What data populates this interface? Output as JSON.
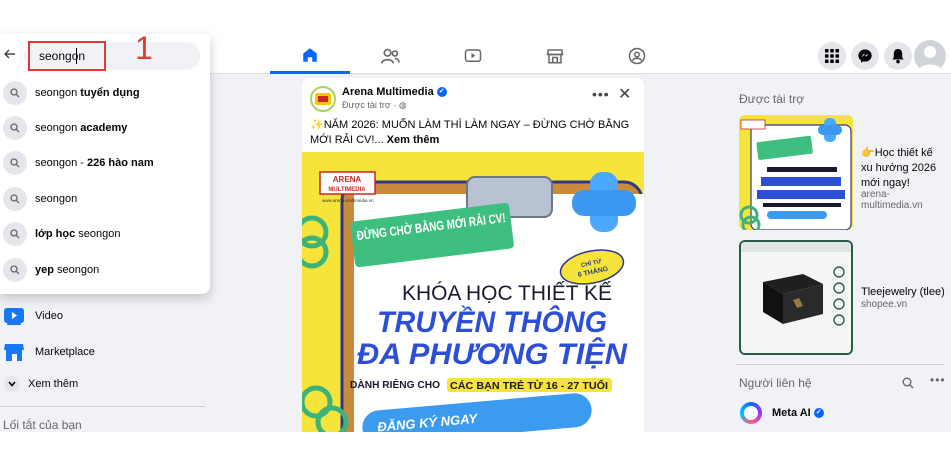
{
  "search": {
    "query": "seongon",
    "step_marker": "1",
    "suggestions": [
      {
        "prefix": "seongon ",
        "bold": "tuyển dụng"
      },
      {
        "prefix": "seongon ",
        "bold": "academy"
      },
      {
        "prefix": "seongon - ",
        "bold": "226 hào nam"
      },
      {
        "prefix": "seongon",
        "bold": ""
      },
      {
        "prefix": "",
        "bold": "lớp học",
        "suffix": " seongon"
      },
      {
        "prefix": "",
        "bold": "yep",
        "suffix": " seongon"
      }
    ]
  },
  "nav": {
    "tabs": [
      "home-icon",
      "friends-icon",
      "watch-icon",
      "marketplace-icon",
      "groups-icon"
    ],
    "active_tab": "home-icon"
  },
  "left": {
    "video_label": "Video",
    "marketplace_label": "Marketplace",
    "see_more_label": "Xem thêm",
    "shortcuts_label": "Lối tắt của bạn"
  },
  "post": {
    "author": "Arena Multimedia",
    "sponsored": "Được tài trợ · ",
    "text": "✨NĂM 2026: MUỐN LÀM THÌ LÀM NGAY – ĐỪNG CHỜ BẰNG MỚI RẢI CV!... ",
    "see_more": "Xem thêm",
    "image": {
      "logo_line1": "ARENA",
      "logo_line2": "MULTIMEDIA",
      "logo_url": "www.arena-multimedia.vn",
      "banner": "ĐỪNG CHỜ BẰNG MỚI RẢI CV!",
      "badge_line1": "CHỈ TỪ",
      "badge_line2": "6 THÁNG",
      "headline1": "KHÓA HỌC THIẾT KẾ",
      "headline2": "TRUYỀN THÔNG",
      "headline3": "ĐA PHƯƠNG TIỆN",
      "audience_prefix": "DÀNH RIÊNG CHO",
      "audience_highlight": "CÁC BẠN TRẺ TỪ 16 - 27 TUỔI",
      "cta": "ĐĂNG KÝ NGAY"
    }
  },
  "right": {
    "sponsored_heading": "Được tài trợ",
    "ads": [
      {
        "title": "👉Học thiết kế xu hướng 2026 mới ngay!",
        "domain": "arena-multimedia.vn"
      },
      {
        "title": "Tleejewelry (tlee)",
        "domain": "shopee.vn"
      }
    ],
    "contacts_heading": "Người liên hệ",
    "contact_name": "Meta AI"
  },
  "colors": {
    "accent": "#0866ff",
    "annotation": "#e53935",
    "ad_yellow": "#f7e43a",
    "ad_blue": "#2d4fd6"
  }
}
